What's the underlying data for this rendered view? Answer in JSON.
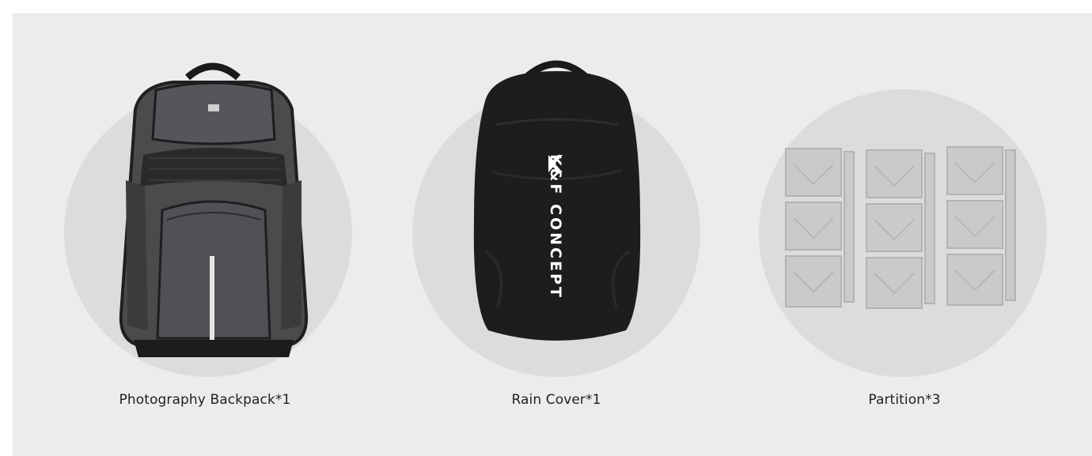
{
  "items": [
    {
      "label": "Photography Backpack*1",
      "icon": "camera-backpack"
    },
    {
      "label": "Rain Cover*1",
      "icon": "rain-cover",
      "brand_text": "K&F CONCEPT"
    },
    {
      "label": "Partition*3",
      "icon": "partition-dividers"
    }
  ],
  "colors": {
    "panel_bg": "#ececec",
    "circle_bg": "#dcdcdc",
    "backpack_body": "#4a4a4c",
    "rain_cover": "#1c1c1e",
    "partition": "#c9c9c9"
  }
}
